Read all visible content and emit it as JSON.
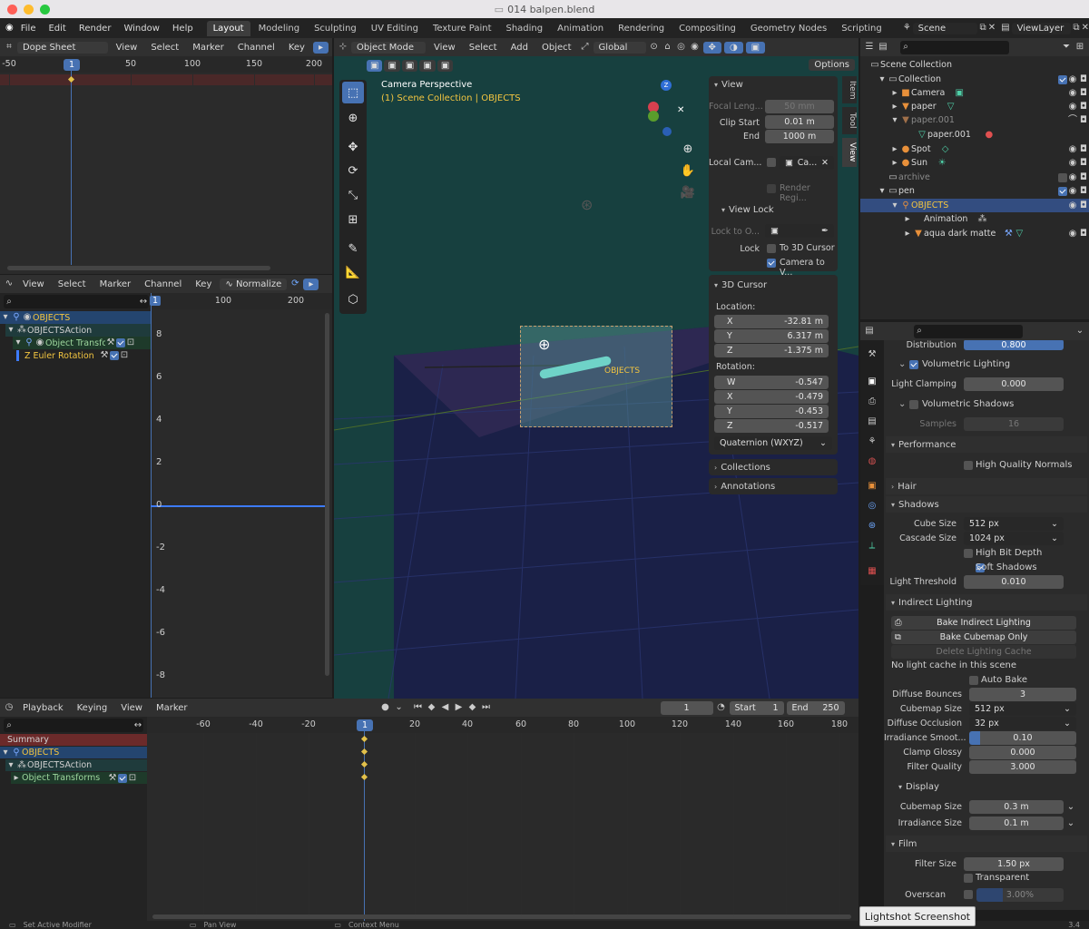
{
  "window": {
    "title": "014 balpen.blend"
  },
  "menu": [
    "File",
    "Edit",
    "Render",
    "Window",
    "Help"
  ],
  "workspaces": [
    "Layout",
    "Modeling",
    "Sculpting",
    "UV Editing",
    "Texture Paint",
    "Shading",
    "Animation",
    "Rendering",
    "Compositing",
    "Geometry Nodes",
    "Scripting"
  ],
  "active_workspace": "Layout",
  "scene": {
    "name": "Scene",
    "view_layer": "ViewLayer"
  },
  "dopesheet": {
    "mode": "Dope Sheet",
    "menus": [
      "View",
      "Select",
      "Marker",
      "Channel",
      "Key"
    ],
    "ruler": [
      "-50",
      "50",
      "100",
      "150",
      "200"
    ],
    "frame": "1"
  },
  "graph": {
    "menus": [
      "View",
      "Select",
      "Marker",
      "Channel",
      "Key"
    ],
    "normalize": "Normalize",
    "ruler": [
      "1",
      "100",
      "200"
    ],
    "yticks": [
      "8",
      "6",
      "4",
      "2",
      "0",
      "-2",
      "-4",
      "-6",
      "-8"
    ],
    "channels": [
      "OBJECTS",
      "OBJECTSAction",
      "Object Transfon",
      "Z Euler Rotation"
    ]
  },
  "viewport": {
    "mode": "Object Mode",
    "menus": [
      "View",
      "Select",
      "Add",
      "Object"
    ],
    "orientation": "Global",
    "options": "Options",
    "perspective": "Camera Perspective",
    "collection": "(1) Scene Collection | OBJECTS",
    "object_label": "OBJECTS",
    "tabs": [
      "Item",
      "Tool",
      "View"
    ]
  },
  "npanel": {
    "view_title": "View",
    "focal_label": "Focal Leng...",
    "focal_value": "50 mm",
    "clip_start_label": "Clip Start",
    "clip_start": "0.01 m",
    "end_label": "End",
    "clip_end": "1000 m",
    "local_cam_label": "Local Cam...",
    "local_cam_value": "Ca...",
    "render_region": "Render Regi...",
    "view_lock_title": "View Lock",
    "lock_to_label": "Lock to O...",
    "lock_label": "Lock",
    "to_3d_cursor": "To 3D Cursor",
    "camera_to_view": "Camera to V...",
    "cursor_title": "3D Cursor",
    "location_label": "Location:",
    "loc": [
      {
        "axis": "X",
        "value": "-32.81 m"
      },
      {
        "axis": "Y",
        "value": "6.317 m"
      },
      {
        "axis": "Z",
        "value": "-1.375 m"
      }
    ],
    "rotation_label": "Rotation:",
    "rot": [
      {
        "axis": "W",
        "value": "-0.547"
      },
      {
        "axis": "X",
        "value": "-0.479"
      },
      {
        "axis": "Y",
        "value": "-0.453"
      },
      {
        "axis": "Z",
        "value": "-0.517"
      }
    ],
    "rot_mode": "Quaternion (WXYZ)",
    "collections": "Collections",
    "annotations": "Annotations"
  },
  "outliner": {
    "root": "Scene Collection",
    "items": [
      "Collection",
      "Camera",
      "paper",
      "paper.001",
      "paper.001",
      "Spot",
      "Sun",
      "archive",
      "pen",
      "OBJECTS",
      "Animation",
      "aqua dark matte"
    ]
  },
  "properties": {
    "distribution_label": "Distribution",
    "distribution": "0.800",
    "volumetric_lighting": "Volumetric Lighting",
    "light_clamping_label": "Light Clamping",
    "light_clamping": "0.000",
    "volumetric_shadows": "Volumetric Shadows",
    "samples_label": "Samples",
    "samples": "16",
    "performance": "Performance",
    "high_quality_normals": "High Quality Normals",
    "hair": "Hair",
    "shadows": "Shadows",
    "cube_size_label": "Cube Size",
    "cube_size": "512 px",
    "cascade_size_label": "Cascade Size",
    "cascade_size": "1024 px",
    "high_bit_depth": "High Bit Depth",
    "soft_shadows": "Soft Shadows",
    "light_threshold_label": "Light Threshold",
    "light_threshold": "0.010",
    "indirect_lighting": "Indirect Lighting",
    "bake_indirect": "Bake Indirect Lighting",
    "bake_cubemap": "Bake Cubemap Only",
    "delete_cache": "Delete Lighting Cache",
    "no_cache": "No light cache in this scene",
    "auto_bake": "Auto Bake",
    "diffuse_bounces_label": "Diffuse Bounces",
    "diffuse_bounces": "3",
    "cubemap_size_label": "Cubemap Size",
    "cubemap_size": "512 px",
    "diffuse_occlusion_label": "Diffuse Occlusion",
    "diffuse_occlusion": "32 px",
    "irradiance_smooth_label": "Irradiance Smoot...",
    "irradiance_smooth": "0.10",
    "clamp_glossy_label": "Clamp Glossy",
    "clamp_glossy": "0.000",
    "filter_quality_label": "Filter Quality",
    "filter_quality": "3.000",
    "display": "Display",
    "display_cubemap_label": "Cubemap Size",
    "display_cubemap": "0.3 m",
    "irradiance_size_label": "Irradiance Size",
    "irradiance_size": "0.1 m",
    "film": "Film",
    "filter_size_label": "Filter Size",
    "filter_size": "1.50 px",
    "transparent": "Transparent",
    "overscan_label": "Overscan",
    "overscan": "3.00%"
  },
  "timeline": {
    "menus": [
      "Playback",
      "Keying",
      "View",
      "Marker"
    ],
    "current_frame": "1",
    "start_label": "Start",
    "start": "1",
    "end_label": "End",
    "end": "250",
    "ruler": [
      "-60",
      "-40",
      "-20",
      "20",
      "40",
      "60",
      "80",
      "100",
      "120",
      "140",
      "160",
      "180"
    ],
    "channels": [
      "Summary",
      "OBJECTS",
      "OBJECTSAction",
      "Object Transforms"
    ]
  },
  "status": {
    "left": "Set Active Modifier",
    "mid": "Pan View",
    "right": "Context Menu",
    "version": "3.4"
  },
  "tooltip": "Lightshot Screenshot",
  "colors": {
    "accent": "#4772b3",
    "viewport_bg": "#17403f",
    "selection": "#334d80",
    "key": "#e3c14a"
  }
}
